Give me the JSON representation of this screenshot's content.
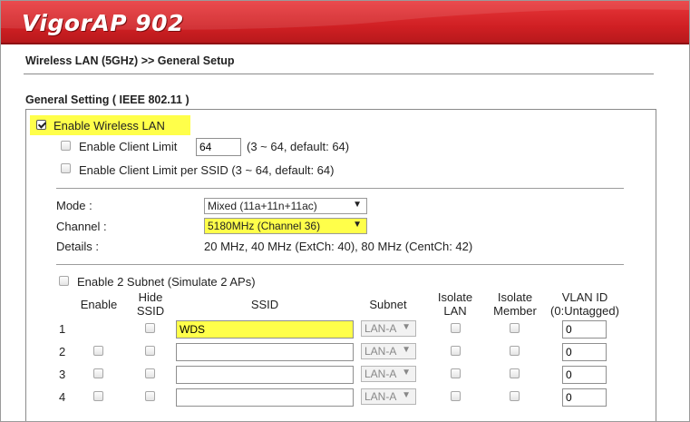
{
  "app": {
    "brand": "VigorAP 902"
  },
  "breadcrumb": "Wireless LAN (5GHz) >> General Setup",
  "section_title": "General Setting ( IEEE 802.11 )",
  "enable_wireless": {
    "label": "Enable Wireless LAN",
    "checked": true
  },
  "client_limit": {
    "label": "Enable Client Limit",
    "value": "64",
    "hint": "(3 ~ 64, default: 64)",
    "checked": false
  },
  "client_limit_ssid": {
    "label": "Enable Client Limit per SSID (3 ~ 64, default: 64)",
    "checked": false
  },
  "mode": {
    "label": "Mode :",
    "value": "Mixed (11a+11n+11ac)"
  },
  "channel": {
    "label": "Channel :",
    "value": "5180MHz (Channel 36)"
  },
  "details": {
    "label": "Details :",
    "value": "20 MHz, 40 MHz (ExtCh: 40), 80 MHz (CentCh: 42)"
  },
  "subnet_toggle": {
    "label": "Enable 2 Subnet (Simulate 2 APs)",
    "checked": false
  },
  "table": {
    "headers": {
      "enable": "Enable",
      "hide_ssid_1": "Hide",
      "hide_ssid_2": "SSID",
      "ssid": "SSID",
      "subnet": "Subnet",
      "isolate_lan_1": "Isolate",
      "isolate_lan_2": "LAN",
      "isolate_member_1": "Isolate",
      "isolate_member_2": "Member",
      "vlan_1": "VLAN ID",
      "vlan_2": "(0:Untagged)"
    },
    "rows": [
      {
        "num": "1",
        "ssid": "WDS",
        "subnet": "LAN-A",
        "vlan": "0"
      },
      {
        "num": "2",
        "ssid": "",
        "subnet": "LAN-A",
        "vlan": "0"
      },
      {
        "num": "3",
        "ssid": "",
        "subnet": "LAN-A",
        "vlan": "0"
      },
      {
        "num": "4",
        "ssid": "",
        "subnet": "LAN-A",
        "vlan": "0"
      }
    ]
  },
  "colors": {
    "header_red": "#cf1f23",
    "highlight": "#ffff4a"
  }
}
